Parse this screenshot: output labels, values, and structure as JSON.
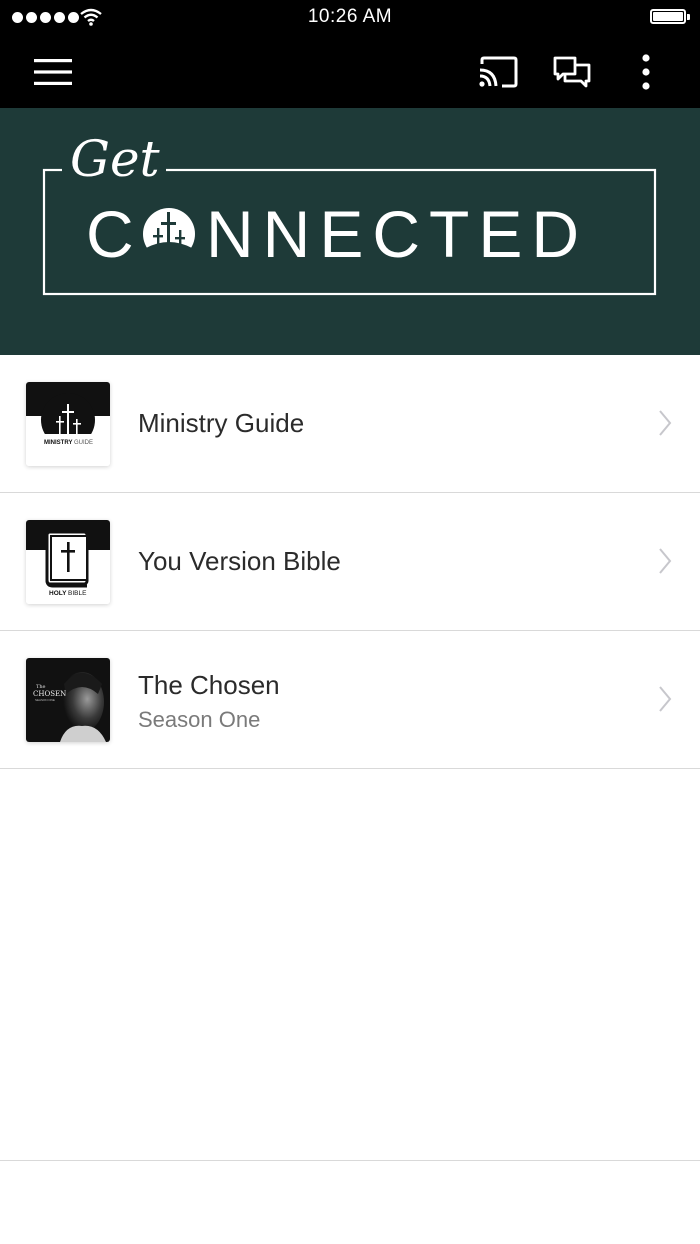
{
  "status_bar": {
    "time": "10:26 AM",
    "signal_icon": "signal-dots-icon",
    "wifi_icon": "wifi-icon",
    "battery_icon": "battery-icon"
  },
  "nav": {
    "menu_icon": "hamburger-menu-icon",
    "cast_icon": "cast-icon",
    "chat_icon": "chat-bubbles-icon",
    "more_icon": "more-vertical-icon"
  },
  "banner": {
    "script_text": "Get",
    "title_before": "C",
    "title_after": "NNECTED",
    "background_color": "#1e3a38"
  },
  "items": [
    {
      "title": "Ministry Guide",
      "subtitle": "",
      "thumb_caption_a": "MINISTRY",
      "thumb_caption_b": "GUIDE"
    },
    {
      "title": "You Version Bible",
      "subtitle": "",
      "thumb_caption_a": "HOLY",
      "thumb_caption_b": "BIBLE"
    },
    {
      "title": "The Chosen",
      "subtitle": "Season One",
      "thumb_caption_a": "The",
      "thumb_caption_b": "CHOSEN",
      "thumb_caption_c": "SEASON ONE"
    }
  ]
}
